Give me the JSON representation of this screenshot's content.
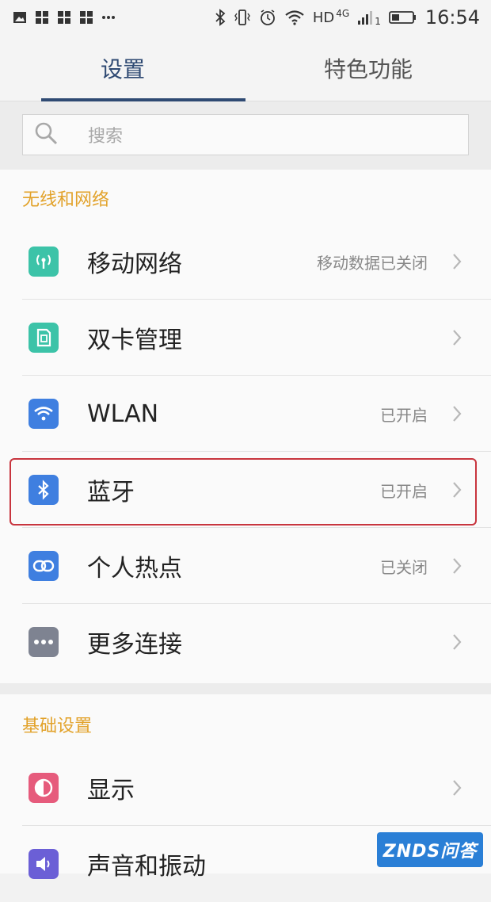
{
  "status_bar": {
    "left_icons": [
      "image-icon",
      "app-grid-icon",
      "app-grid-icon",
      "app-grid-icon",
      "more-dots-icon"
    ],
    "right_icons": [
      "bluetooth-icon",
      "vibrate-icon",
      "alarm-icon",
      "wifi-icon"
    ],
    "hd_label": "HD",
    "network_label": "4G",
    "sim_label": "1",
    "time": "16:54"
  },
  "tabs": [
    {
      "label": "设置",
      "active": true
    },
    {
      "label": "特色功能",
      "active": false
    }
  ],
  "search": {
    "placeholder": "搜索"
  },
  "sections": [
    {
      "title": "无线和网络",
      "items": [
        {
          "label": "移动网络",
          "value": "移动数据已关闭",
          "icon": "cellular-antenna-icon",
          "color": "#3cc3a8"
        },
        {
          "label": "双卡管理",
          "value": "",
          "icon": "sim-card-icon",
          "color": "#3cc3a8"
        },
        {
          "label": "WLAN",
          "value": "已开启",
          "icon": "wifi-icon",
          "color": "#3f7fe0"
        },
        {
          "label": "蓝牙",
          "value": "已开启",
          "icon": "bluetooth-icon",
          "color": "#3f7fe0"
        },
        {
          "label": "个人热点",
          "value": "已关闭",
          "icon": "link-icon",
          "color": "#3f7fe0"
        },
        {
          "label": "更多连接",
          "value": "",
          "icon": "more-dots-icon",
          "color": "#7e8391"
        }
      ]
    },
    {
      "title": "基础设置",
      "items": [
        {
          "label": "显示",
          "value": "",
          "icon": "display-icon",
          "color": "#e65b7c"
        },
        {
          "label": "声音和振动",
          "value": "",
          "icon": "sound-icon",
          "color": "#6b5fd6"
        }
      ]
    }
  ],
  "highlight_color": "#c8353e",
  "watermark": {
    "text": "ZNDS问答"
  }
}
